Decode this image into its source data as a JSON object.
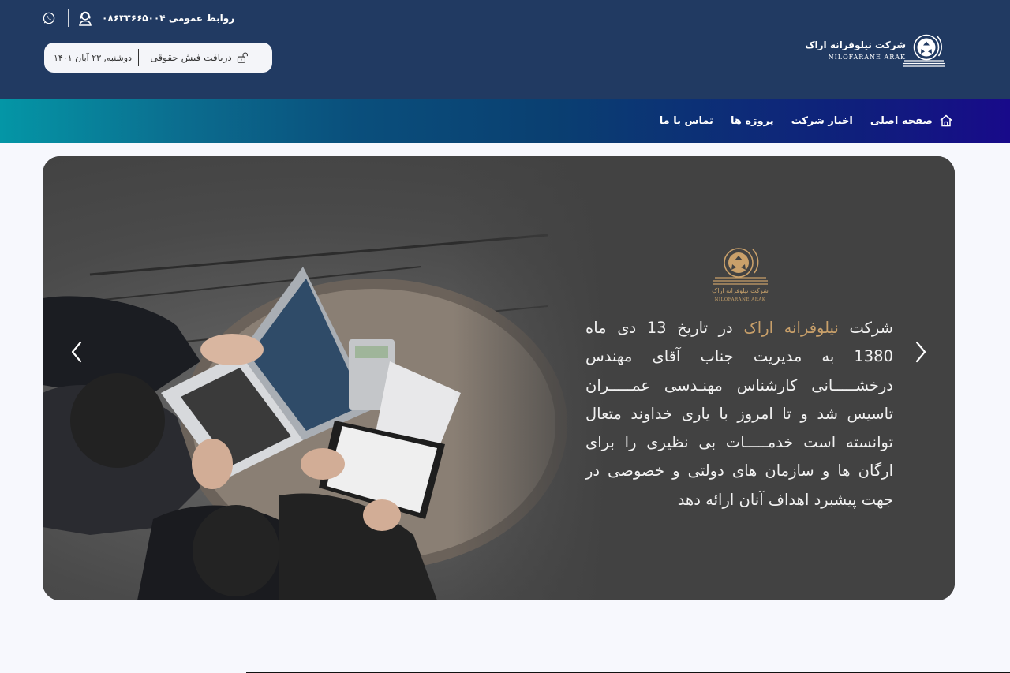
{
  "header": {
    "contact_label": "روابط عمومی ۰۸۶۳۳۶۶۵۰۰۴",
    "date_text": "دوشنبه, ۲۳ آبان ۱۴۰۱",
    "payslip_label": "دریافت فیش حقوقی",
    "logo_name": "شرکت نیلوفرانه اراک",
    "logo_sub": "NILOFARANE ARAK"
  },
  "nav": {
    "items": [
      {
        "label": "صفحه اصلی",
        "icon": "home-icon"
      },
      {
        "label": "اخبار شرکت"
      },
      {
        "label": "پروژه ها"
      },
      {
        "label": "تماس با ما"
      }
    ]
  },
  "slider": {
    "logo_name": "شرکت نیلوفرانه اراک",
    "logo_sub": "NILOFARANE ARAK",
    "text_before": "شرکت ",
    "text_highlight": "نیلوفرانه اراک",
    "text_after": " در تاریخ 13 دی ماه 1380 به مدیریت جناب آقای مهندس درخشـــــانی کارشناس مهنـدسی عمـــــران تاسیس شد و تا امروز با یاری خداوند متعال توانسته است خدمـــــات بی نظیری را برای ارگان ها و سازمان های دولتی و خصوصی در جهت پیشبرد اهداف آنان ارائه دهد"
  },
  "colors": {
    "header_bg": "#213a62",
    "accent_gold": "#c9a06a",
    "nav_gradient_start": "#0496a6",
    "nav_gradient_end": "#180a8a"
  }
}
